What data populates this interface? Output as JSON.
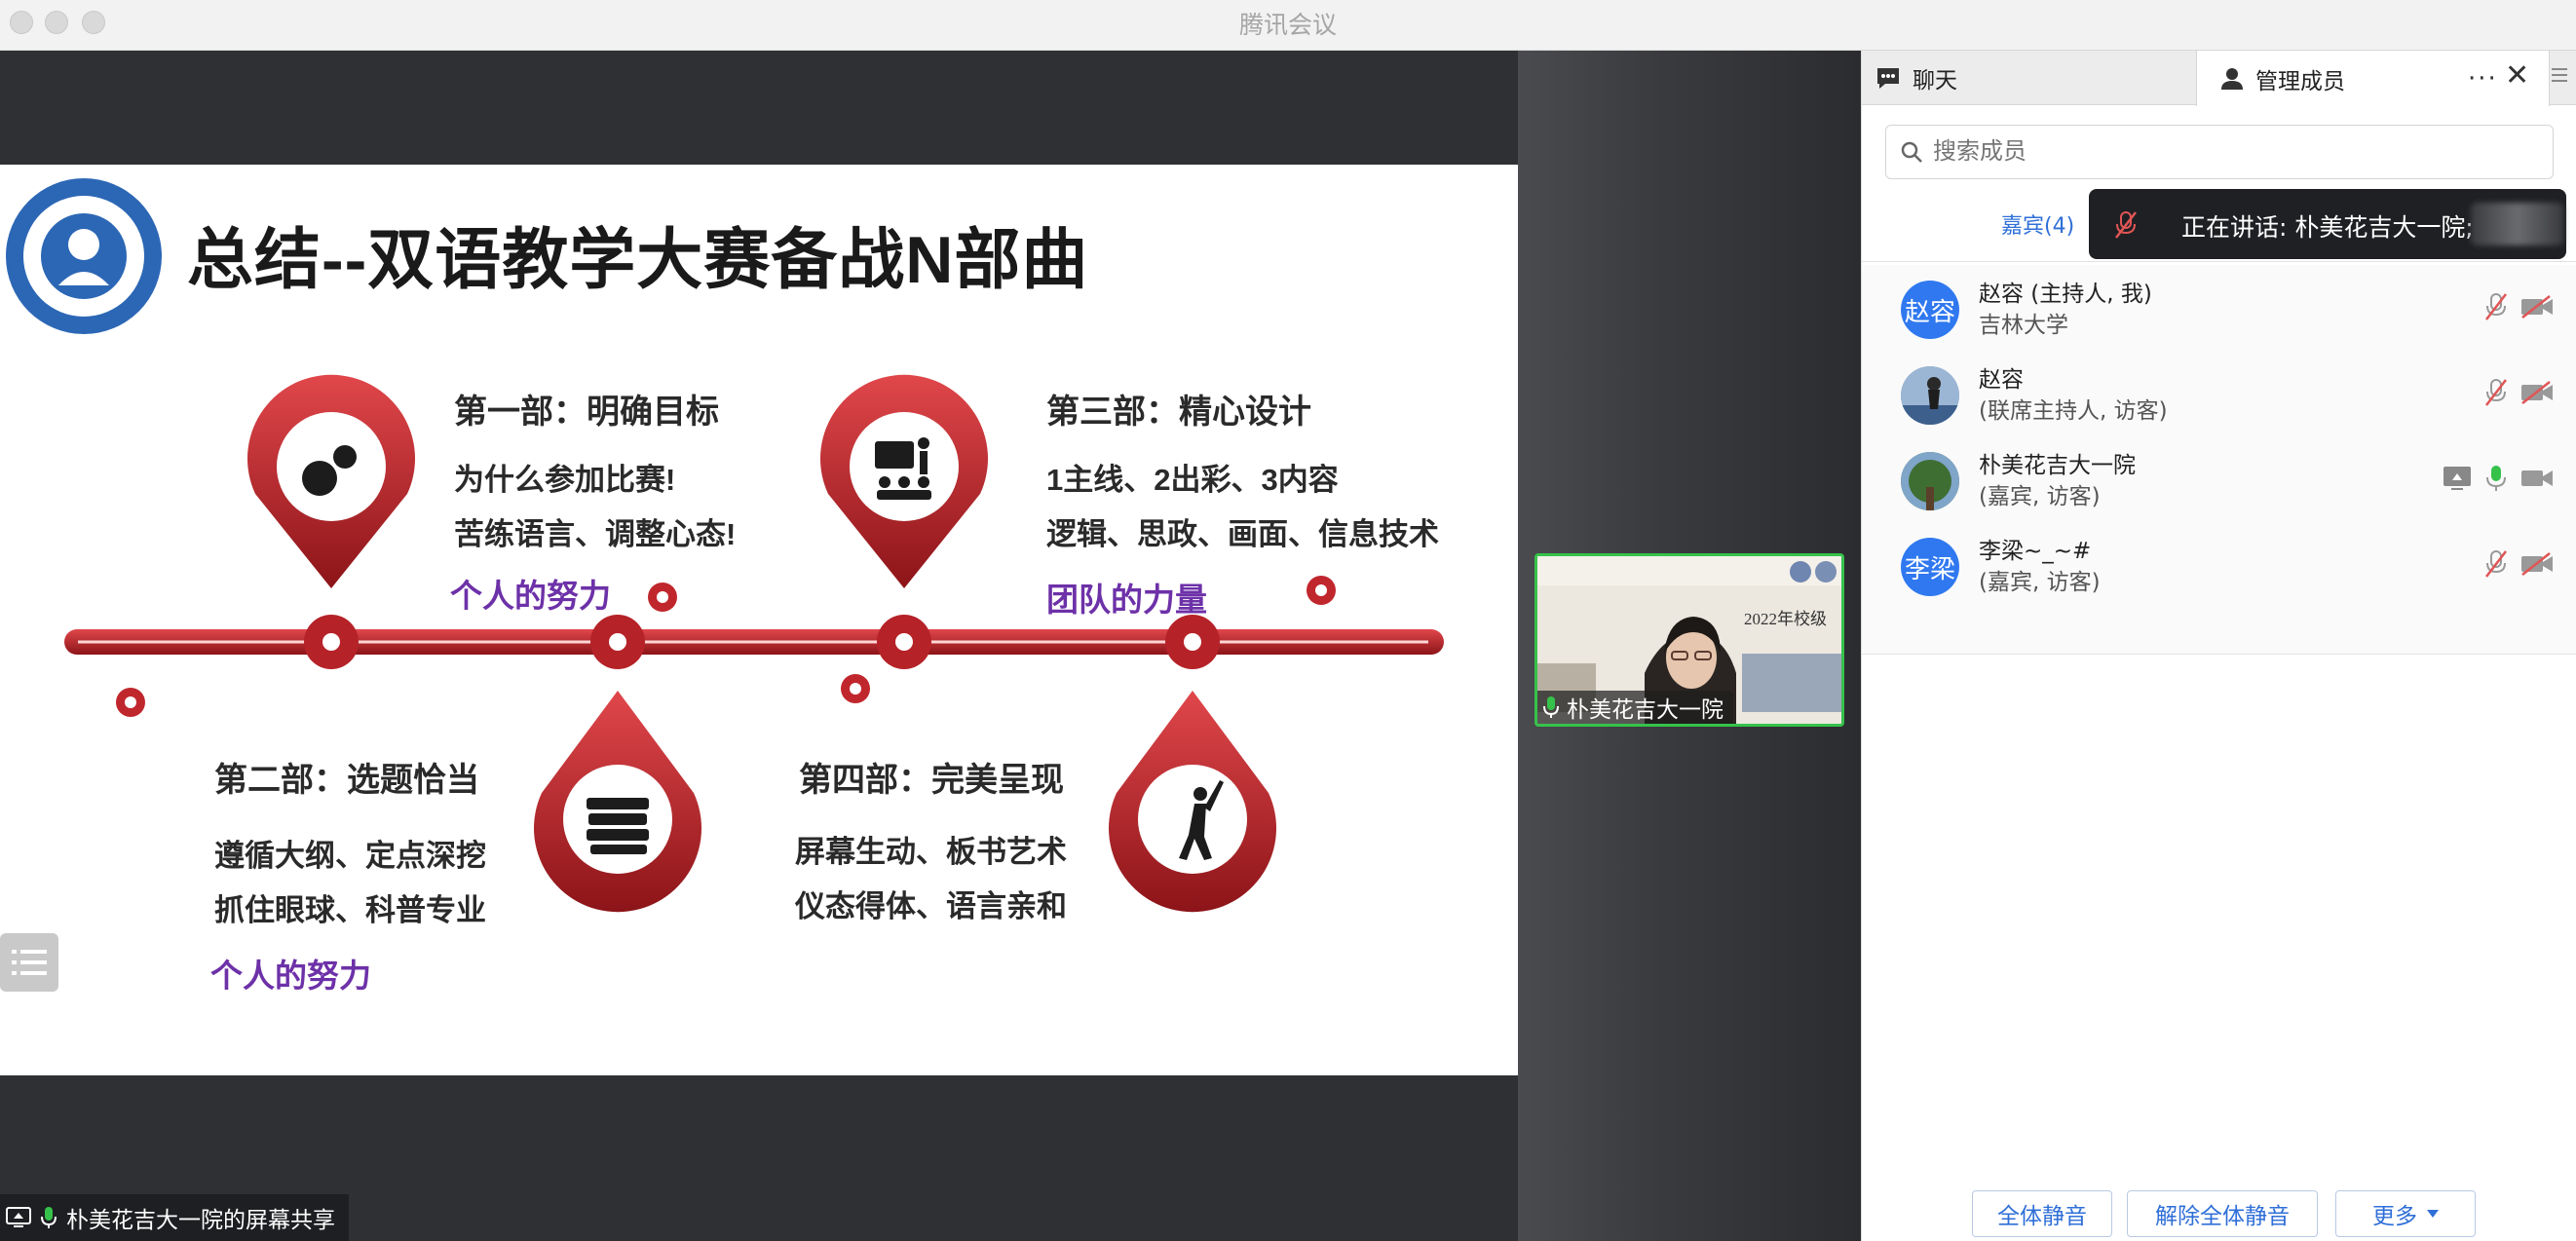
{
  "window": {
    "title": "腾讯会议"
  },
  "slide": {
    "title": "总结--双语教学大赛备战N部曲",
    "part1": {
      "heading": "第一部：明确目标",
      "lines": [
        "为什么参加比赛!",
        "苦练语言、调整心态!"
      ],
      "tag": "个人的努力"
    },
    "part2": {
      "heading": "第二部：选题恰当",
      "lines": [
        "遵循大纲、定点深挖",
        "抓住眼球、科普专业"
      ],
      "tag": "个人的努力"
    },
    "part3": {
      "heading": "第三部：精心设计",
      "lines": [
        "1主线、2出彩、3内容",
        "逻辑、思政、画面、信息技术"
      ],
      "tag": "团队的力量"
    },
    "part4": {
      "heading": "第四部：完美呈现",
      "lines": [
        "屏幕生动、板书艺术",
        "仪态得体、语言亲和"
      ]
    }
  },
  "video": {
    "name": "朴美花吉大一院",
    "backdrop_text": "2022年校级"
  },
  "share_label": "朴美花吉大一院的屏幕共享",
  "panel": {
    "tabs": {
      "chat": "聊天",
      "members": "管理成员"
    },
    "more": "···",
    "close": "✕",
    "search_placeholder": "搜索成员",
    "guest_tab": "嘉宾(4)",
    "speaking": "正在讲话: 朴美花吉大一院;",
    "members": [
      {
        "avatar_text": "赵容",
        "name": "赵容 (主持人, 我)",
        "sub": "吉林大学",
        "avatar_color": "#2f78f0",
        "mic": "muted",
        "cam": "off"
      },
      {
        "avatar_text": "",
        "name": "赵容",
        "sub": "(联席主持人, 访客)",
        "avatar_color": "#8aa6c8",
        "mic": "muted",
        "cam": "off"
      },
      {
        "avatar_text": "",
        "name": "朴美花吉大一院",
        "sub": "(嘉宾, 访客)",
        "avatar_color": "#4c7a3c",
        "mic": "on",
        "cam": "on",
        "sharing": true
      },
      {
        "avatar_text": "李梁",
        "name": "李梁~_~#",
        "sub": "(嘉宾, 访客)",
        "avatar_color": "#2f78f0",
        "mic": "muted",
        "cam": "off"
      }
    ],
    "footer": {
      "mute_all": "全体静音",
      "unmute_all": "解除全体静音",
      "more": "更多"
    }
  },
  "colors": {
    "accent": "#2f6fd8",
    "slide_red": "#c0272d",
    "slide_purple": "#6d31a8",
    "speaking_green": "#36c24a"
  }
}
